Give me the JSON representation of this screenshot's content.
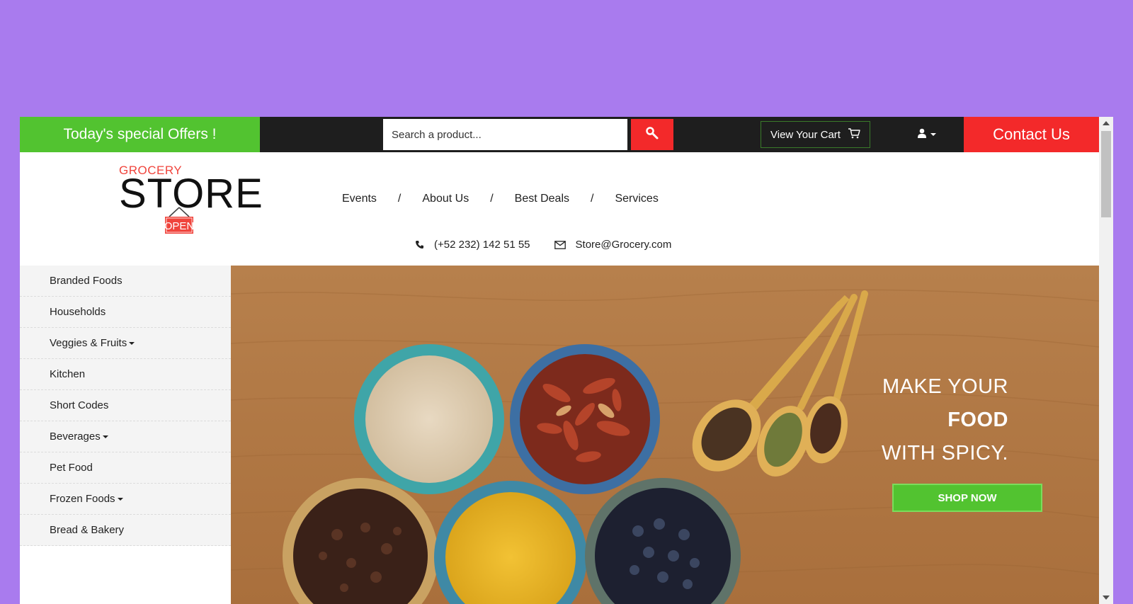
{
  "topbar": {
    "offers_label": "Today's special Offers !",
    "search_placeholder": "Search a product...",
    "search_icon": "search-icon",
    "cart_label": "View Your Cart",
    "cart_icon": "cart-icon",
    "user_icon": "user-icon",
    "contact_label": "Contact Us"
  },
  "logo": {
    "top": "GROCERY",
    "main": "STORE",
    "sign": "OPEN"
  },
  "nav": {
    "items": [
      {
        "label": "Events"
      },
      {
        "label": "About Us"
      },
      {
        "label": "Best Deals"
      },
      {
        "label": "Services"
      }
    ],
    "separator": "/"
  },
  "contact": {
    "phone": "(+52 232) 142 51 55",
    "email": "Store@Grocery.com",
    "phone_icon": "phone-icon",
    "email_icon": "envelope-icon"
  },
  "sidebar": {
    "items": [
      {
        "label": "Branded Foods",
        "dropdown": false
      },
      {
        "label": "Households",
        "dropdown": false
      },
      {
        "label": "Veggies & Fruits",
        "dropdown": true
      },
      {
        "label": "Kitchen",
        "dropdown": false
      },
      {
        "label": "Short Codes",
        "dropdown": false
      },
      {
        "label": "Beverages",
        "dropdown": true
      },
      {
        "label": "Pet Food",
        "dropdown": false
      },
      {
        "label": "Frozen Foods",
        "dropdown": true
      },
      {
        "label": "Bread & Bakery",
        "dropdown": false
      }
    ]
  },
  "hero": {
    "line1": "MAKE YOUR",
    "line2": "FOOD",
    "line3": "WITH SPICY.",
    "button_label": "SHOP NOW"
  },
  "colors": {
    "background": "#a97bee",
    "green": "#52c330",
    "red": "#f3292a",
    "dark": "#1e1e1e",
    "wood": "#b57a45"
  }
}
